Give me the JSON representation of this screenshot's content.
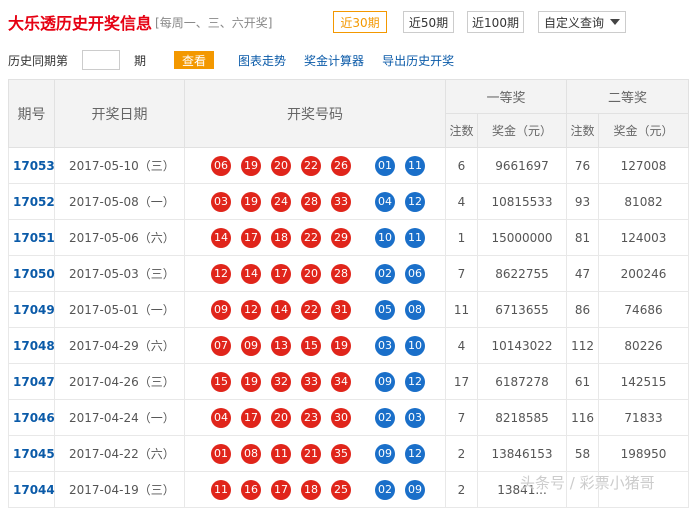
{
  "header": {
    "title": "大乐透历史开奖信息",
    "subtitle": "[每周一、三、六开奖]",
    "tabs": [
      "近30期",
      "近50期",
      "近100期"
    ],
    "custom_query": "自定义查询"
  },
  "query_row": {
    "label": "历史同期第",
    "input_value": "",
    "unit": "期",
    "query_button": "查看",
    "links": [
      "图表走势",
      "奖金计算器",
      "导出历史开奖"
    ]
  },
  "table": {
    "headers": {
      "period": "期号",
      "date": "开奖日期",
      "numbers": "开奖号码",
      "first_prize": "一等奖",
      "second_prize": "二等奖",
      "count": "注数",
      "amount": "奖金（元）"
    },
    "rows": [
      {
        "period": "17053",
        "date": "2017-05-10（三）",
        "red": [
          "06",
          "19",
          "20",
          "22",
          "26"
        ],
        "blue": [
          "01",
          "11"
        ],
        "c1": "6",
        "a1": "9661697",
        "c2": "76",
        "a2": "127008"
      },
      {
        "period": "17052",
        "date": "2017-05-08（一）",
        "red": [
          "03",
          "19",
          "24",
          "28",
          "33"
        ],
        "blue": [
          "04",
          "12"
        ],
        "c1": "4",
        "a1": "10815533",
        "c2": "93",
        "a2": "81082"
      },
      {
        "period": "17051",
        "date": "2017-05-06（六）",
        "red": [
          "14",
          "17",
          "18",
          "22",
          "29"
        ],
        "blue": [
          "10",
          "11"
        ],
        "c1": "1",
        "a1": "15000000",
        "c2": "81",
        "a2": "124003"
      },
      {
        "period": "17050",
        "date": "2017-05-03（三）",
        "red": [
          "12",
          "14",
          "17",
          "20",
          "28"
        ],
        "blue": [
          "02",
          "06"
        ],
        "c1": "7",
        "a1": "8622755",
        "c2": "47",
        "a2": "200246"
      },
      {
        "period": "17049",
        "date": "2017-05-01（一）",
        "red": [
          "09",
          "12",
          "14",
          "22",
          "31"
        ],
        "blue": [
          "05",
          "08"
        ],
        "c1": "11",
        "a1": "6713655",
        "c2": "86",
        "a2": "74686"
      },
      {
        "period": "17048",
        "date": "2017-04-29（六）",
        "red": [
          "07",
          "09",
          "13",
          "15",
          "19"
        ],
        "blue": [
          "03",
          "10"
        ],
        "c1": "4",
        "a1": "10143022",
        "c2": "112",
        "a2": "80226"
      },
      {
        "period": "17047",
        "date": "2017-04-26（三）",
        "red": [
          "15",
          "19",
          "32",
          "33",
          "34"
        ],
        "blue": [
          "09",
          "12"
        ],
        "c1": "17",
        "a1": "6187278",
        "c2": "61",
        "a2": "142515"
      },
      {
        "period": "17046",
        "date": "2017-04-24（一）",
        "red": [
          "04",
          "17",
          "20",
          "23",
          "30"
        ],
        "blue": [
          "02",
          "03"
        ],
        "c1": "7",
        "a1": "8218585",
        "c2": "116",
        "a2": "71833"
      },
      {
        "period": "17045",
        "date": "2017-04-22（六）",
        "red": [
          "01",
          "08",
          "11",
          "21",
          "35"
        ],
        "blue": [
          "09",
          "12"
        ],
        "c1": "2",
        "a1": "13846153",
        "c2": "58",
        "a2": "198950"
      },
      {
        "period": "17044",
        "date": "2017-04-19（三）",
        "red": [
          "11",
          "16",
          "17",
          "18",
          "25"
        ],
        "blue": [
          "02",
          "09"
        ],
        "c1": "2",
        "a1": "13841...",
        "c2": "",
        "a2": ""
      }
    ]
  },
  "watermark": "头条号 / 彩票小猪哥",
  "colors": {
    "accent": "#f39800",
    "red_ball": "#e0251b",
    "blue_ball": "#1a6fc9",
    "title": "#e60012",
    "link": "#0a5aa8"
  }
}
